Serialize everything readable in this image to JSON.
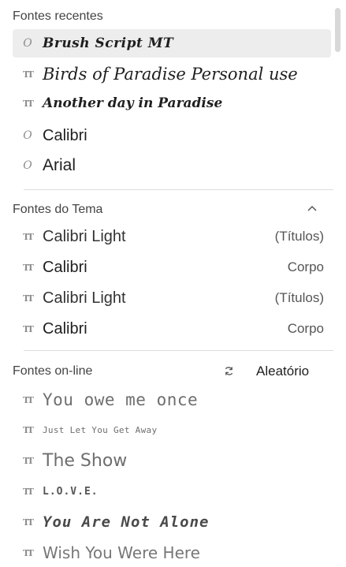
{
  "recent": {
    "header": "Fontes recentes",
    "items": [
      {
        "name": "Brush Script MT",
        "icon": "opentype-icon"
      },
      {
        "name": "Birds of Paradise  Personal use",
        "icon": "truetype-icon"
      },
      {
        "name": "Another day in Paradise",
        "icon": "truetype-icon"
      },
      {
        "name": "Calibri",
        "icon": "opentype-icon"
      },
      {
        "name": "Arial",
        "icon": "opentype-icon"
      }
    ]
  },
  "theme": {
    "header": "Fontes do Tema",
    "items": [
      {
        "name": "Calibri Light",
        "tag": "(Títulos)"
      },
      {
        "name": "Calibri",
        "tag": "Corpo"
      },
      {
        "name": "Calibri Light",
        "tag": "(Títulos)"
      },
      {
        "name": "Calibri",
        "tag": "Corpo"
      }
    ]
  },
  "online": {
    "header": "Fontes on-line",
    "random_label": "Aleatório",
    "items": [
      {
        "name": "You owe me once"
      },
      {
        "name": "Just Let You Get Away"
      },
      {
        "name": "The Show"
      },
      {
        "name": "L.O.V.E."
      },
      {
        "name": "You Are Not Alone"
      },
      {
        "name": "Wish You Were Here"
      }
    ]
  }
}
